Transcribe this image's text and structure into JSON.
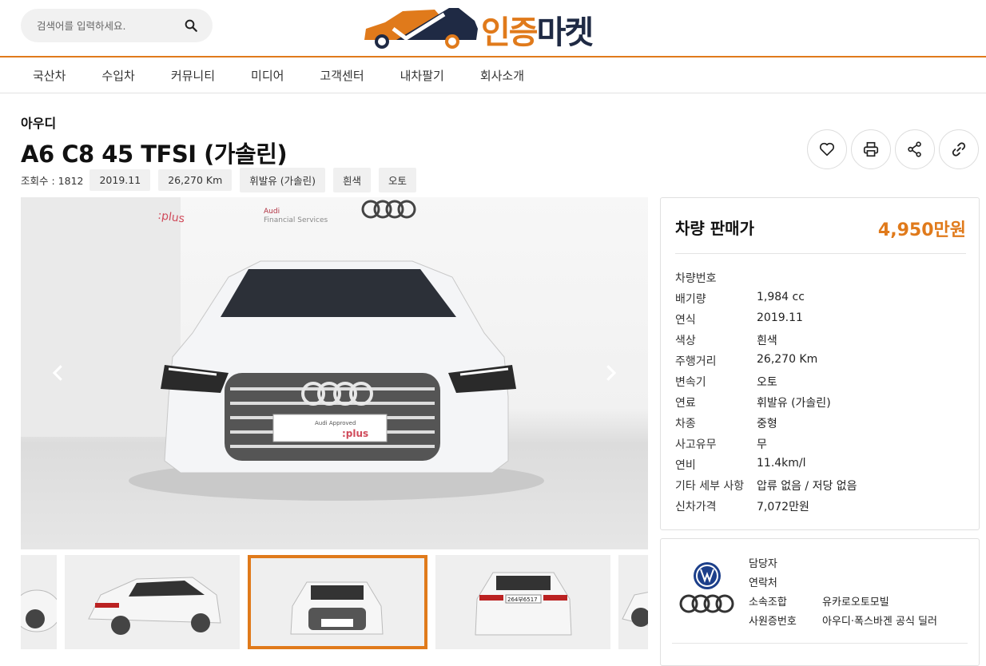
{
  "search": {
    "placeholder": "검색어를 입력하세요."
  },
  "logo": {
    "part1": "인증",
    "part2": "마켓"
  },
  "nav": [
    "국산차",
    "수입차",
    "커뮤니티",
    "미디어",
    "고객센터",
    "내차팔기",
    "회사소개"
  ],
  "car": {
    "brand": "아우디",
    "title": "A6 C8 45 TFSI (가솔린)",
    "views": "조회수 : 1812",
    "tags": [
      "2019.11",
      "26,270 Km",
      "휘발유 (가솔린)",
      "흰색",
      "오토"
    ]
  },
  "image": {
    "fs_text_1": "Audi",
    "fs_text_2": "Financial Services",
    "plate_main": "Audi Approved",
    "plate_brand": ":plus",
    "wall_brand": ":plus",
    "rear_plate": "264부6517"
  },
  "price": {
    "label": "차량 판매가",
    "value": "4,950만원"
  },
  "specs": [
    {
      "k": "차량번호",
      "v": ""
    },
    {
      "k": "배기량",
      "v": "1,984 cc"
    },
    {
      "k": "연식",
      "v": "2019.11"
    },
    {
      "k": "색상",
      "v": "흰색"
    },
    {
      "k": "주행거리",
      "v": "26,270 Km"
    },
    {
      "k": "변속기",
      "v": "오토"
    },
    {
      "k": "연료",
      "v": "휘발유 (가솔린)"
    },
    {
      "k": "차종",
      "v": "중형"
    },
    {
      "k": "사고유무",
      "v": "무"
    },
    {
      "k": "연비",
      "v": "11.4km/l"
    },
    {
      "k": "기타 세부 사항",
      "v": "압류 없음 / 저당 없음"
    },
    {
      "k": "신차가격",
      "v": "7,072만원"
    }
  ],
  "dealer": [
    {
      "k": "담당자",
      "v": ""
    },
    {
      "k": "연락처",
      "v": ""
    },
    {
      "k": "소속조합",
      "v": "유카로오토모빌"
    },
    {
      "k": "사원증번호",
      "v": "아우디·폭스바겐 공식 딜러"
    }
  ],
  "colors": {
    "accent": "#e07a1b",
    "navy": "#1f2a44"
  },
  "icons": [
    "search-icon",
    "heart-icon",
    "print-icon",
    "share-icon",
    "link-icon",
    "chevron-left-icon",
    "chevron-right-icon"
  ]
}
